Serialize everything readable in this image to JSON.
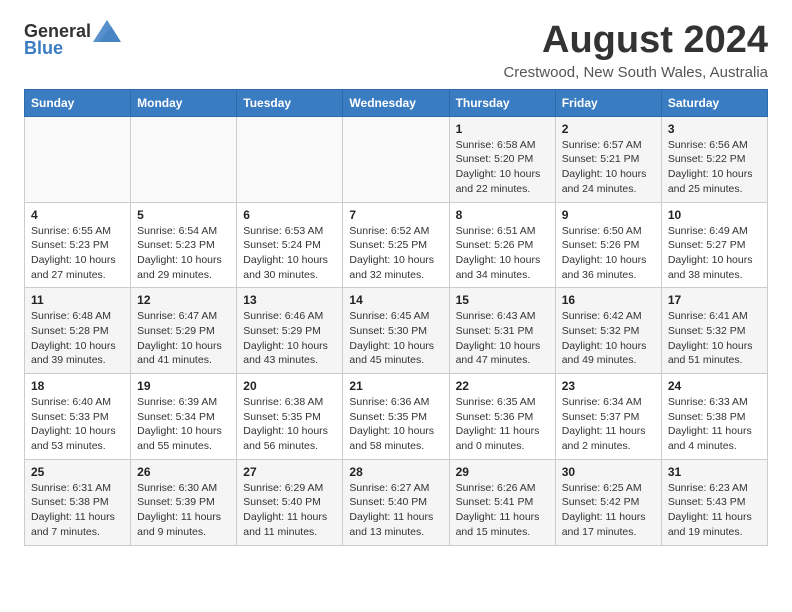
{
  "header": {
    "logo_general": "General",
    "logo_blue": "Blue",
    "title": "August 2024",
    "subtitle": "Crestwood, New South Wales, Australia"
  },
  "calendar": {
    "days_of_week": [
      "Sunday",
      "Monday",
      "Tuesday",
      "Wednesday",
      "Thursday",
      "Friday",
      "Saturday"
    ],
    "weeks": [
      [
        {
          "day": "",
          "info": ""
        },
        {
          "day": "",
          "info": ""
        },
        {
          "day": "",
          "info": ""
        },
        {
          "day": "",
          "info": ""
        },
        {
          "day": "1",
          "info": "Sunrise: 6:58 AM\nSunset: 5:20 PM\nDaylight: 10 hours\nand 22 minutes."
        },
        {
          "day": "2",
          "info": "Sunrise: 6:57 AM\nSunset: 5:21 PM\nDaylight: 10 hours\nand 24 minutes."
        },
        {
          "day": "3",
          "info": "Sunrise: 6:56 AM\nSunset: 5:22 PM\nDaylight: 10 hours\nand 25 minutes."
        }
      ],
      [
        {
          "day": "4",
          "info": "Sunrise: 6:55 AM\nSunset: 5:23 PM\nDaylight: 10 hours\nand 27 minutes."
        },
        {
          "day": "5",
          "info": "Sunrise: 6:54 AM\nSunset: 5:23 PM\nDaylight: 10 hours\nand 29 minutes."
        },
        {
          "day": "6",
          "info": "Sunrise: 6:53 AM\nSunset: 5:24 PM\nDaylight: 10 hours\nand 30 minutes."
        },
        {
          "day": "7",
          "info": "Sunrise: 6:52 AM\nSunset: 5:25 PM\nDaylight: 10 hours\nand 32 minutes."
        },
        {
          "day": "8",
          "info": "Sunrise: 6:51 AM\nSunset: 5:26 PM\nDaylight: 10 hours\nand 34 minutes."
        },
        {
          "day": "9",
          "info": "Sunrise: 6:50 AM\nSunset: 5:26 PM\nDaylight: 10 hours\nand 36 minutes."
        },
        {
          "day": "10",
          "info": "Sunrise: 6:49 AM\nSunset: 5:27 PM\nDaylight: 10 hours\nand 38 minutes."
        }
      ],
      [
        {
          "day": "11",
          "info": "Sunrise: 6:48 AM\nSunset: 5:28 PM\nDaylight: 10 hours\nand 39 minutes."
        },
        {
          "day": "12",
          "info": "Sunrise: 6:47 AM\nSunset: 5:29 PM\nDaylight: 10 hours\nand 41 minutes."
        },
        {
          "day": "13",
          "info": "Sunrise: 6:46 AM\nSunset: 5:29 PM\nDaylight: 10 hours\nand 43 minutes."
        },
        {
          "day": "14",
          "info": "Sunrise: 6:45 AM\nSunset: 5:30 PM\nDaylight: 10 hours\nand 45 minutes."
        },
        {
          "day": "15",
          "info": "Sunrise: 6:43 AM\nSunset: 5:31 PM\nDaylight: 10 hours\nand 47 minutes."
        },
        {
          "day": "16",
          "info": "Sunrise: 6:42 AM\nSunset: 5:32 PM\nDaylight: 10 hours\nand 49 minutes."
        },
        {
          "day": "17",
          "info": "Sunrise: 6:41 AM\nSunset: 5:32 PM\nDaylight: 10 hours\nand 51 minutes."
        }
      ],
      [
        {
          "day": "18",
          "info": "Sunrise: 6:40 AM\nSunset: 5:33 PM\nDaylight: 10 hours\nand 53 minutes."
        },
        {
          "day": "19",
          "info": "Sunrise: 6:39 AM\nSunset: 5:34 PM\nDaylight: 10 hours\nand 55 minutes."
        },
        {
          "day": "20",
          "info": "Sunrise: 6:38 AM\nSunset: 5:35 PM\nDaylight: 10 hours\nand 56 minutes."
        },
        {
          "day": "21",
          "info": "Sunrise: 6:36 AM\nSunset: 5:35 PM\nDaylight: 10 hours\nand 58 minutes."
        },
        {
          "day": "22",
          "info": "Sunrise: 6:35 AM\nSunset: 5:36 PM\nDaylight: 11 hours\nand 0 minutes."
        },
        {
          "day": "23",
          "info": "Sunrise: 6:34 AM\nSunset: 5:37 PM\nDaylight: 11 hours\nand 2 minutes."
        },
        {
          "day": "24",
          "info": "Sunrise: 6:33 AM\nSunset: 5:38 PM\nDaylight: 11 hours\nand 4 minutes."
        }
      ],
      [
        {
          "day": "25",
          "info": "Sunrise: 6:31 AM\nSunset: 5:38 PM\nDaylight: 11 hours\nand 7 minutes."
        },
        {
          "day": "26",
          "info": "Sunrise: 6:30 AM\nSunset: 5:39 PM\nDaylight: 11 hours\nand 9 minutes."
        },
        {
          "day": "27",
          "info": "Sunrise: 6:29 AM\nSunset: 5:40 PM\nDaylight: 11 hours\nand 11 minutes."
        },
        {
          "day": "28",
          "info": "Sunrise: 6:27 AM\nSunset: 5:40 PM\nDaylight: 11 hours\nand 13 minutes."
        },
        {
          "day": "29",
          "info": "Sunrise: 6:26 AM\nSunset: 5:41 PM\nDaylight: 11 hours\nand 15 minutes."
        },
        {
          "day": "30",
          "info": "Sunrise: 6:25 AM\nSunset: 5:42 PM\nDaylight: 11 hours\nand 17 minutes."
        },
        {
          "day": "31",
          "info": "Sunrise: 6:23 AM\nSunset: 5:43 PM\nDaylight: 11 hours\nand 19 minutes."
        }
      ]
    ]
  }
}
